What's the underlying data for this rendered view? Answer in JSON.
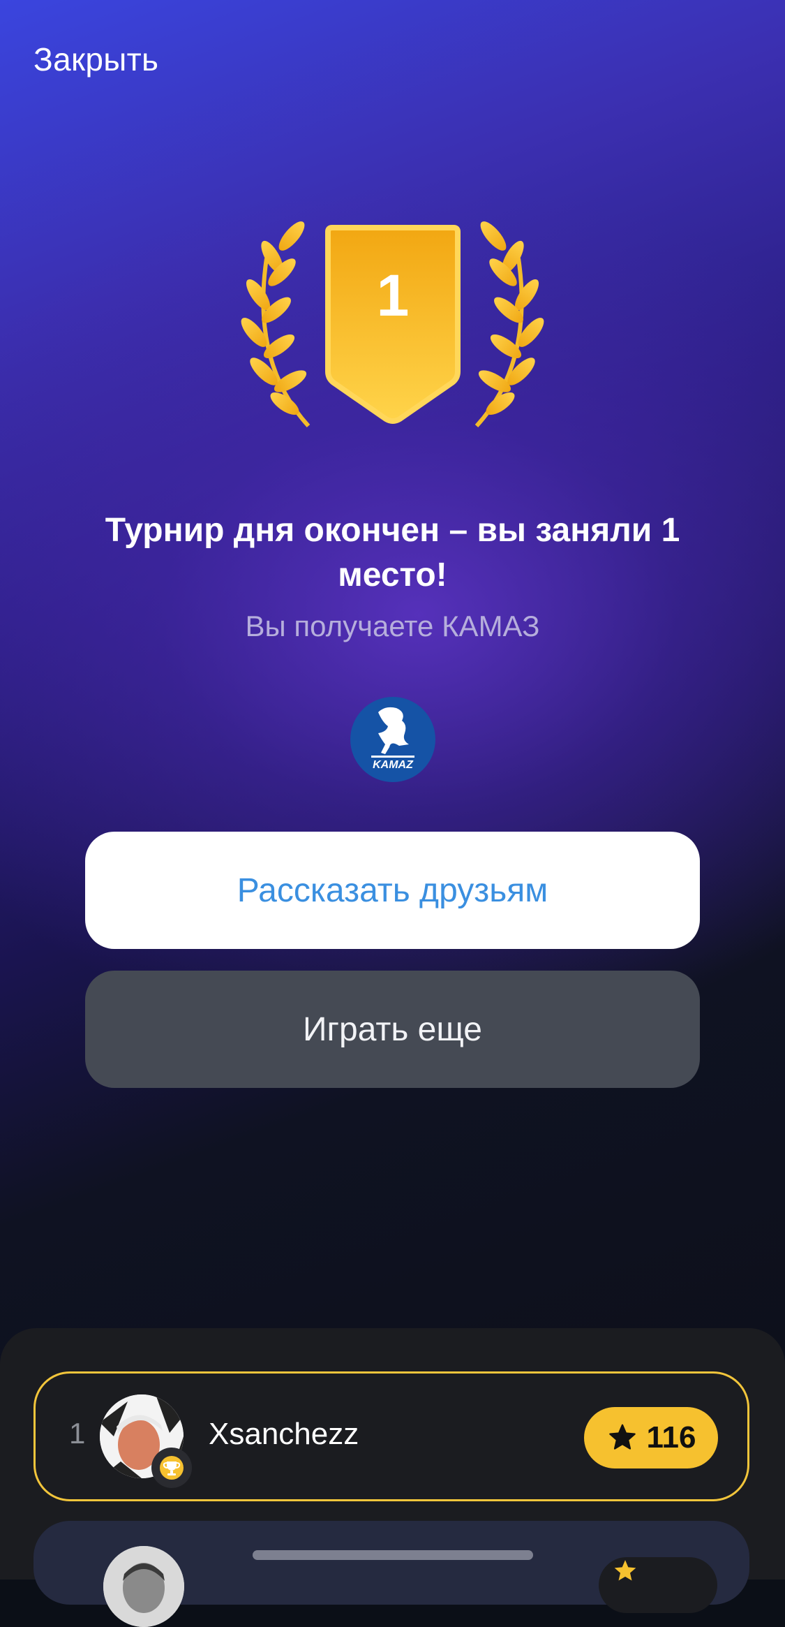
{
  "header": {
    "close_label": "Закрыть"
  },
  "badge": {
    "place": "1"
  },
  "result": {
    "title": "Турнир дня окончен – вы заняли 1 место!",
    "subtitle": "Вы получаете КАМАЗ",
    "prize_logo_text": "KAMAZ"
  },
  "buttons": {
    "share_label": "Рассказать друзьям",
    "play_again_label": "Играть еще"
  },
  "leaderboard": {
    "rows": [
      {
        "rank": "1",
        "username": "Xsanchezz",
        "score": "116",
        "highlighted": true
      }
    ]
  },
  "colors": {
    "accent_gold": "#f6c12f",
    "link_blue": "#3a8fe0",
    "kamaz_blue": "#1553a6"
  },
  "icons": [
    "laurel-left-icon",
    "laurel-right-icon",
    "trophy-icon",
    "star-icon"
  ]
}
